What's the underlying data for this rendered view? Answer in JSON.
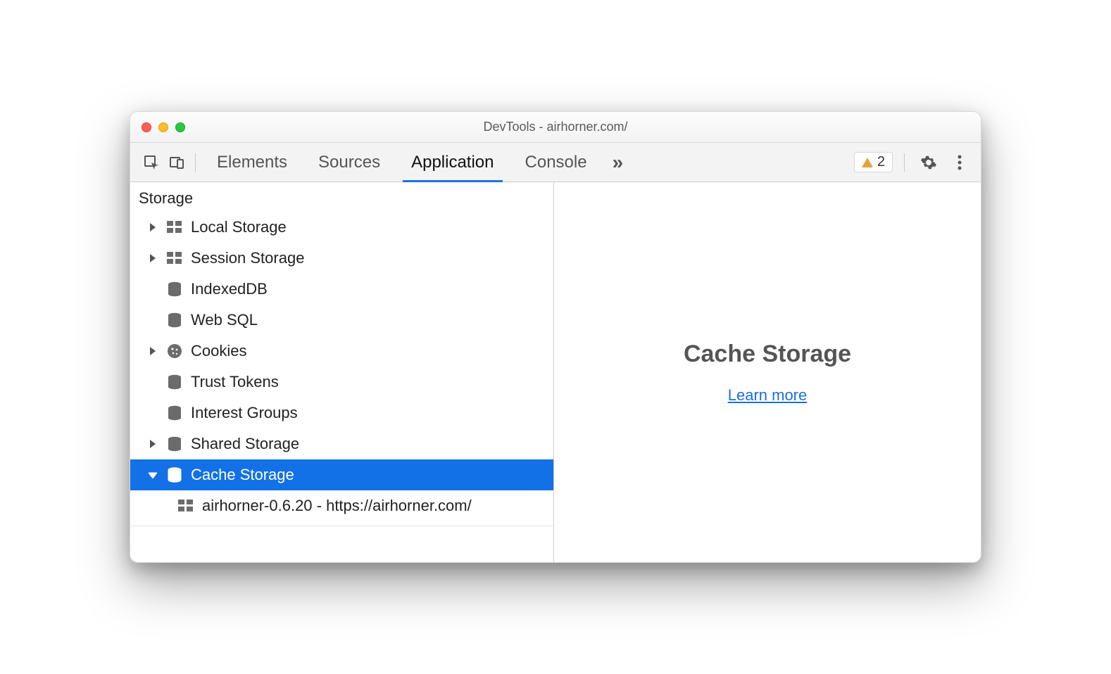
{
  "window": {
    "title": "DevTools - airhorner.com/"
  },
  "tabs": {
    "items": [
      "Elements",
      "Sources",
      "Application",
      "Console"
    ],
    "active_index": 2
  },
  "toolbar": {
    "warning_count": "2"
  },
  "sidebar": {
    "section": "Storage",
    "items": [
      {
        "label": "Local Storage",
        "icon": "grid",
        "expandable": true,
        "expanded": false
      },
      {
        "label": "Session Storage",
        "icon": "grid",
        "expandable": true,
        "expanded": false
      },
      {
        "label": "IndexedDB",
        "icon": "db",
        "expandable": false
      },
      {
        "label": "Web SQL",
        "icon": "db",
        "expandable": false
      },
      {
        "label": "Cookies",
        "icon": "cookie",
        "expandable": true,
        "expanded": false
      },
      {
        "label": "Trust Tokens",
        "icon": "db",
        "expandable": false
      },
      {
        "label": "Interest Groups",
        "icon": "db",
        "expandable": false
      },
      {
        "label": "Shared Storage",
        "icon": "db",
        "expandable": true,
        "expanded": false
      },
      {
        "label": "Cache Storage",
        "icon": "db",
        "expandable": true,
        "expanded": true,
        "selected": true,
        "children": [
          {
            "label": "airhorner-0.6.20 - https://airhorner.com/",
            "icon": "grid"
          }
        ]
      }
    ]
  },
  "main": {
    "heading": "Cache Storage",
    "link_label": "Learn more"
  },
  "colors": {
    "accent": "#1271e6",
    "tab_indicator": "#1a73e8"
  }
}
